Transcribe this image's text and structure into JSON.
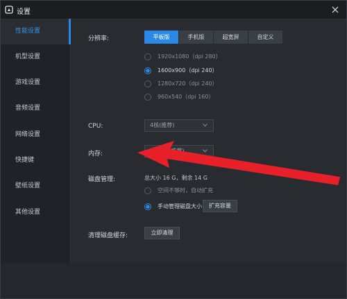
{
  "window": {
    "title": "设置"
  },
  "sidebar": {
    "items": [
      {
        "label": "性能设置",
        "active": true
      },
      {
        "label": "机型设置"
      },
      {
        "label": "游戏设置"
      },
      {
        "label": "音频设置"
      },
      {
        "label": "网络设置"
      },
      {
        "label": "快捷键"
      },
      {
        "label": "壁纸设置"
      },
      {
        "label": "其他设置"
      }
    ]
  },
  "resolution": {
    "label": "分辨率:",
    "tabs": [
      "平板版",
      "手机版",
      "超宽屏",
      "自定义"
    ],
    "active_tab": 0,
    "options": [
      "1920x1080（dpi 280）",
      "1600x900（dpi 240）",
      "1280x720（dpi 240）",
      "960x540（dpi 160）"
    ],
    "selected_option": 1
  },
  "cpu": {
    "label": "CPU:",
    "value": "4核(推荐)"
  },
  "memory": {
    "label": "内存:",
    "value": "2046M(推荐)"
  },
  "disk": {
    "label": "磁盘管理:",
    "summary": "总大小 16 G，剩余 14 G",
    "options": [
      "空间不够时，自动扩充",
      "手动管理磁盘大小"
    ],
    "selected_option": 1,
    "expand_button": "扩充容量"
  },
  "cache": {
    "label": "清理磁盘缓存:",
    "button": "立即清理"
  },
  "colors": {
    "accent": "#2a89e6",
    "annotation_arrow": "#e8202a"
  }
}
